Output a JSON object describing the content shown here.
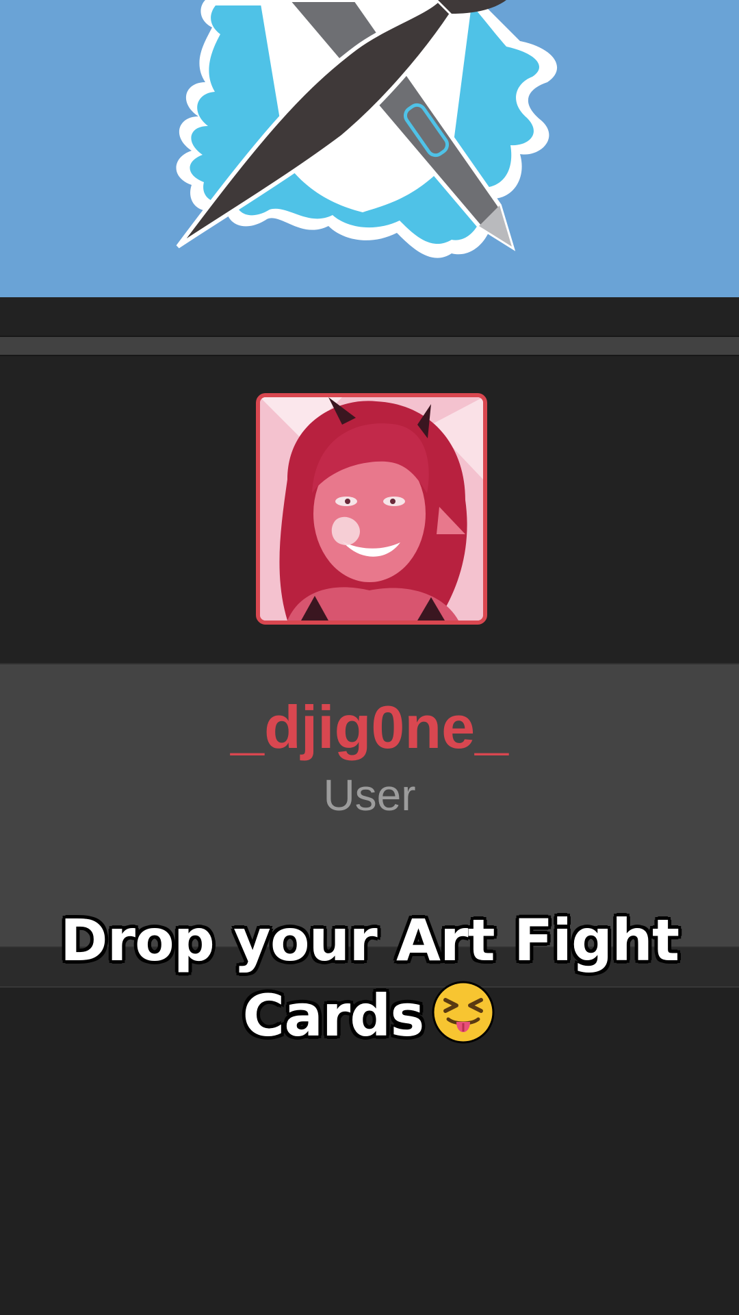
{
  "profile": {
    "username": "_djig0ne_",
    "role": "User"
  },
  "caption": {
    "line1": "Drop your Art Fight",
    "line2": "Cards",
    "emoji": "squinting-face-with-tongue"
  },
  "banner": {
    "icon": "art-fight-logo-icon",
    "background_color": "#6aa3d6"
  },
  "avatar": {
    "icon": "profile-avatar-image",
    "border_color": "#d94750"
  },
  "colors": {
    "accent": "#d94750",
    "panel": "#444444",
    "background": "#212121"
  }
}
